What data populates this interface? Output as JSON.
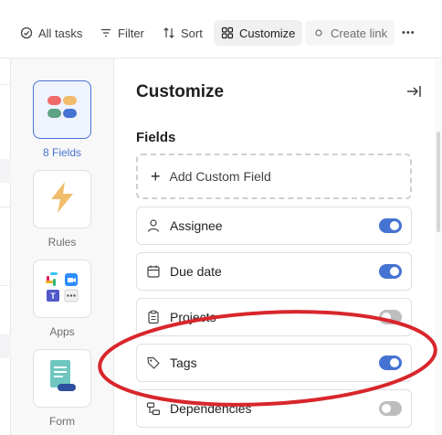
{
  "toolbar": {
    "all_tasks": "All tasks",
    "filter": "Filter",
    "sort": "Sort",
    "customize": "Customize",
    "create_link": "Create link",
    "more": "•••"
  },
  "apps": [
    {
      "label": "8 Fields",
      "icon": "fields-icon",
      "selected": true
    },
    {
      "label": "Rules",
      "icon": "lightning-icon",
      "selected": false
    },
    {
      "label": "Apps",
      "icon": "apps-grid-icon",
      "selected": false
    },
    {
      "label": "Form",
      "icon": "form-icon",
      "selected": false
    }
  ],
  "panel": {
    "title": "Customize",
    "section": "Fields",
    "add_field": "Add Custom Field",
    "fields": [
      {
        "label": "Assignee",
        "icon": "person-icon",
        "enabled": true
      },
      {
        "label": "Due date",
        "icon": "calendar-icon",
        "enabled": true
      },
      {
        "label": "Projects",
        "icon": "clipboard-icon",
        "enabled": false
      },
      {
        "label": "Tags",
        "icon": "tag-icon",
        "enabled": true
      },
      {
        "label": "Dependencies",
        "icon": "dependencies-icon",
        "enabled": false
      }
    ]
  },
  "colors": {
    "accent": "#4573d2",
    "annotation": "#d8262c",
    "toggle_off": "#bdbdbd"
  }
}
